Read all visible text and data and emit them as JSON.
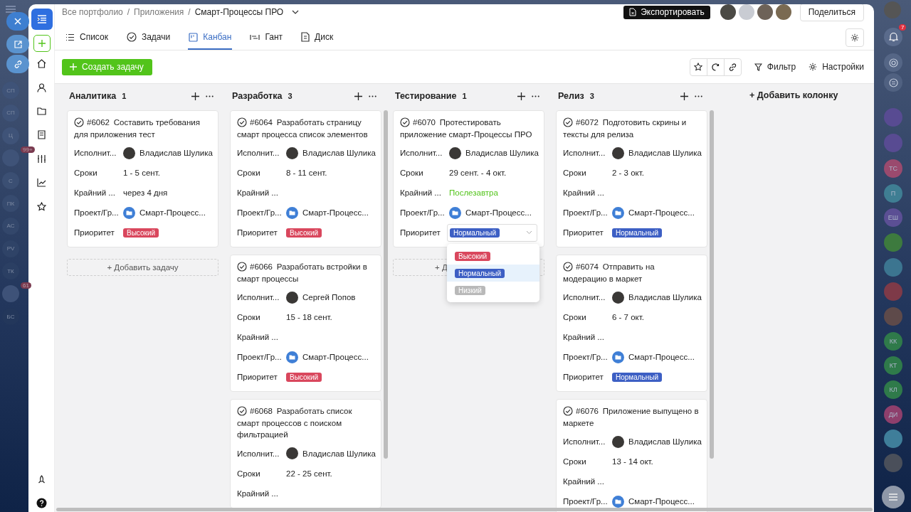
{
  "background_app": {
    "left_items": [
      {
        "initials": "СП",
        "color": "#3f5378"
      },
      {
        "initials": "СП",
        "color": "#3f5378"
      },
      {
        "initials": "Ц",
        "color": "#3f5378"
      },
      {
        "badge": "99+",
        "color": "#3f5378"
      },
      {
        "initials": "С",
        "color": "#3b4f73"
      },
      {
        "initials": "ПК",
        "color": "#374b6f"
      },
      {
        "initials": "АС",
        "color": "#33476b"
      },
      {
        "initials": "PV",
        "color": "#2f4367"
      },
      {
        "initials": "ТК",
        "color": "#2b3f63"
      },
      {
        "badge": "61",
        "color": "#3e5278"
      },
      {
        "initials": "БС",
        "color": "#23375b"
      }
    ],
    "right_items": [
      {
        "initials": "ТС",
        "color": "#9a4a6e"
      },
      {
        "initials": "П",
        "color": "#3f7e93"
      },
      {
        "initials": "ЕШ",
        "color": "#5b4f94"
      },
      {
        "initials": "КК",
        "color": "#2f7a4a"
      },
      {
        "initials": "КТ",
        "color": "#2f7a4a"
      },
      {
        "initials": "КЛ",
        "color": "#2f7a4a"
      },
      {
        "initials": "ДИ",
        "color": "#8e3f6c"
      }
    ],
    "notifications_badge": "7"
  },
  "breadcrumbs": {
    "separator": "/",
    "items": [
      "Все портфолио",
      "Приложения",
      "Смарт-Процессы ПРО"
    ]
  },
  "export_button": "Экспортировать",
  "share_button": "Поделиться",
  "tabs": [
    {
      "label": "Список",
      "selected": false
    },
    {
      "label": "Задачи",
      "selected": false
    },
    {
      "label": "Канбан",
      "selected": true
    },
    {
      "label": "Гант",
      "selected": false
    },
    {
      "label": "Диск",
      "selected": false
    }
  ],
  "create_button": "Создать задачу",
  "toolbar": {
    "filter": "Фильтр",
    "settings": "Настройки"
  },
  "add_column": "+ Добавить колонку",
  "columns": [
    {
      "title": "Аналитика",
      "count": "1",
      "add_task": {
        "label": "+ Добавить задачу",
        "partially_hidden": false
      },
      "cards": [
        {
          "number": "#6062",
          "title": "Составить требования для приложения тест",
          "fields": [
            {
              "kind": "assignee",
              "label": "Исполнит...",
              "value": "Владислав Шулика"
            },
            {
              "kind": "text",
              "label": "Сроки",
              "value": "1 - 5 сент."
            },
            {
              "kind": "text",
              "label": "Крайний ...",
              "value": "через 4 дня"
            },
            {
              "kind": "project",
              "label": "Проект/Гр...",
              "value": "Смарт-Процесс..."
            },
            {
              "kind": "priority",
              "label": "Приоритет",
              "value": "Высокий",
              "color": "#d9475d"
            }
          ]
        }
      ]
    },
    {
      "title": "Разработка",
      "count": "3",
      "cards": [
        {
          "number": "#6064",
          "title": "Разработать страницу смарт процесса список элементов",
          "fields": [
            {
              "kind": "assignee",
              "label": "Исполнит...",
              "value": "Владислав Шулика"
            },
            {
              "kind": "text",
              "label": "Сроки",
              "value": "8 - 11 сент."
            },
            {
              "kind": "text",
              "label": "Крайний ..."
            },
            {
              "kind": "project",
              "label": "Проект/Гр...",
              "value": "Смарт-Процесс..."
            },
            {
              "kind": "priority",
              "label": "Приоритет",
              "value": "Высокий",
              "color": "#d9475d"
            }
          ]
        },
        {
          "number": "#6066",
          "title": "Разработать встройки в смарт процессы",
          "fields": [
            {
              "kind": "assignee",
              "label": "Исполнит...",
              "value": "Сергей Попов"
            },
            {
              "kind": "text",
              "label": "Сроки",
              "value": "15 - 18 сент."
            },
            {
              "kind": "text",
              "label": "Крайний ..."
            },
            {
              "kind": "project",
              "label": "Проект/Гр...",
              "value": "Смарт-Процесс..."
            },
            {
              "kind": "priority",
              "label": "Приоритет",
              "value": "Высокий",
              "color": "#d9475d"
            }
          ]
        },
        {
          "number": "#6068",
          "title": "Разработать список смарт процессов с поиском фильтрацией",
          "fields": [
            {
              "kind": "assignee",
              "label": "Исполнит...",
              "value": "Владислав Шулика"
            },
            {
              "kind": "text",
              "label": "Сроки",
              "value": "22 - 25 сент."
            },
            {
              "kind": "text",
              "label": "Крайний ..."
            }
          ]
        }
      ]
    },
    {
      "title": "Тестирование",
      "count": "1",
      "add_task": {
        "label": "+ Д",
        "partially_hidden": true
      },
      "cards": [
        {
          "number": "#6070",
          "title": "Протестировать приложение смарт-Процессы ПРО",
          "fields": [
            {
              "kind": "assignee",
              "label": "Исполнит...",
              "value": "Владислав Шулика"
            },
            {
              "kind": "text",
              "label": "Сроки",
              "value": "29 сент. - 4 окт."
            },
            {
              "kind": "text",
              "label": "Крайний ...",
              "value": "Послезавтра",
              "color": "#52c41a"
            },
            {
              "kind": "project",
              "label": "Проект/Гр...",
              "value": "Смарт-Процесс..."
            },
            {
              "kind": "priority",
              "label": "Приоритет",
              "value": "Нормальный",
              "color": "#3d5fc4",
              "open": true,
              "options": [
                {
                  "label": "Высокий",
                  "color": "#d9475d",
                  "selected": false
                },
                {
                  "label": "Нормальный",
                  "color": "#3d5fc4",
                  "selected": true
                },
                {
                  "label": "Низкий",
                  "color": "#b9b9b9",
                  "selected": false
                }
              ]
            }
          ]
        }
      ]
    },
    {
      "title": "Релиз",
      "count": "3",
      "cards": [
        {
          "number": "#6072",
          "title": "Подготовить скрины и тексты для релиза",
          "fields": [
            {
              "kind": "assignee",
              "label": "Исполнит...",
              "value": "Владислав Шулика"
            },
            {
              "kind": "text",
              "label": "Сроки",
              "value": "2 - 3 окт."
            },
            {
              "kind": "text",
              "label": "Крайний ..."
            },
            {
              "kind": "project",
              "label": "Проект/Гр...",
              "value": "Смарт-Процесс..."
            },
            {
              "kind": "priority",
              "label": "Приоритет",
              "value": "Нормальный",
              "color": "#3d5fc4"
            }
          ]
        },
        {
          "number": "#6074",
          "title": "Отправить на модерацию в маркет",
          "fields": [
            {
              "kind": "assignee",
              "label": "Исполнит...",
              "value": "Владислав Шулика"
            },
            {
              "kind": "text",
              "label": "Сроки",
              "value": "6 - 7 окт."
            },
            {
              "kind": "text",
              "label": "Крайний ..."
            },
            {
              "kind": "project",
              "label": "Проект/Гр...",
              "value": "Смарт-Процесс..."
            },
            {
              "kind": "priority",
              "label": "Приоритет",
              "value": "Нормальный",
              "color": "#3d5fc4"
            }
          ]
        },
        {
          "number": "#6076",
          "title": "Приложение выпущено в маркете",
          "fields": [
            {
              "kind": "assignee",
              "label": "Исполнит...",
              "value": "Владислав Шулика"
            },
            {
              "kind": "text",
              "label": "Сроки",
              "value": "13 - 14 окт."
            },
            {
              "kind": "text",
              "label": "Крайний ..."
            },
            {
              "kind": "project",
              "label": "Проект/Гр...",
              "value": "Смарт-Процесс..."
            }
          ]
        }
      ]
    }
  ]
}
